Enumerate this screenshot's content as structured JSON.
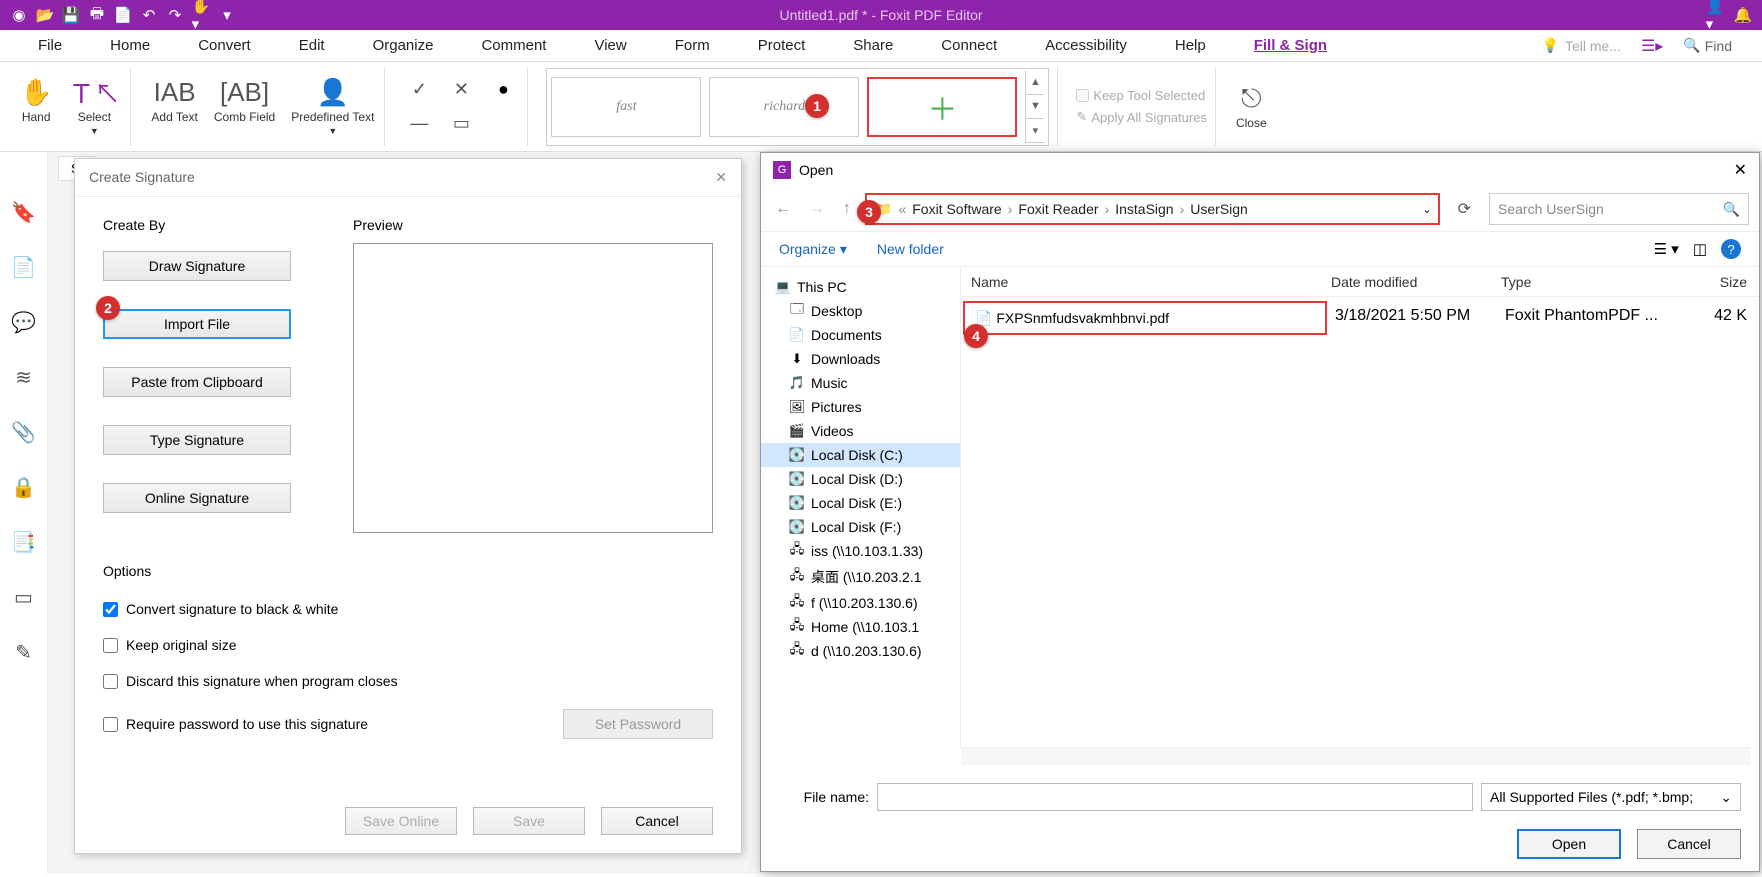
{
  "window": {
    "title": "Untitled1.pdf * - Foxit PDF Editor"
  },
  "menu": {
    "items": [
      "File",
      "Home",
      "Convert",
      "Edit",
      "Organize",
      "Comment",
      "View",
      "Form",
      "Protect",
      "Share",
      "Connect",
      "Accessibility",
      "Help",
      "Fill & Sign"
    ],
    "active": "Fill & Sign",
    "tellMe": "Tell me...",
    "find": "Find"
  },
  "ribbon": {
    "hand": "Hand",
    "select": "Select",
    "addText": "Add Text",
    "combField": "Comb Field",
    "predefinedText": "Predefined Text",
    "keepTool": "Keep Tool Selected",
    "applyAll": "Apply All Signatures",
    "close": "Close",
    "sigSlots": [
      "fast",
      "richard"
    ]
  },
  "docTab": "St",
  "sigDialog": {
    "title": "Create Signature",
    "createBy": "Create By",
    "preview": "Preview",
    "btnDraw": "Draw Signature",
    "btnImport": "Import File",
    "btnPaste": "Paste from Clipboard",
    "btnType": "Type Signature",
    "btnOnline": "Online Signature",
    "options": "Options",
    "optBW": "Convert signature to black & white",
    "optKeep": "Keep original size",
    "optDiscard": "Discard this signature when program closes",
    "optPwd": "Require password to use this signature",
    "setPwd": "Set Password",
    "saveOnline": "Save Online",
    "save": "Save",
    "cancel": "Cancel"
  },
  "openDialog": {
    "title": "Open",
    "breadcrumb": [
      "Foxit Software",
      "Foxit Reader",
      "InstaSign",
      "UserSign"
    ],
    "searchPlaceholder": "Search UserSign",
    "organize": "Organize",
    "newFolder": "New folder",
    "tree": {
      "thisPC": "This PC",
      "items": [
        "Desktop",
        "Documents",
        "Downloads",
        "Music",
        "Pictures",
        "Videos",
        "Local Disk (C:)",
        "Local Disk (D:)",
        "Local Disk (E:)",
        "Local Disk (F:)",
        "iss (\\\\10.103.1.33)",
        "桌面 (\\\\10.203.2.1",
        "f (\\\\10.203.130.6)",
        "Home (\\\\10.103.1",
        "d (\\\\10.203.130.6)"
      ],
      "selected": "Local Disk (C:)"
    },
    "columns": {
      "name": "Name",
      "date": "Date modified",
      "type": "Type",
      "size": "Size"
    },
    "file": {
      "name": "FXPSnmfudsvakmhbnvi.pdf",
      "date": "3/18/2021 5:50 PM",
      "type": "Foxit PhantomPDF ...",
      "size": "42 K"
    },
    "fileNameLabel": "File name:",
    "filter": "All Supported Files (*.pdf; *.bmp;",
    "open": "Open",
    "cancel": "Cancel"
  },
  "callouts": {
    "c1": "1",
    "c2": "2",
    "c3": "3",
    "c4": "4"
  }
}
